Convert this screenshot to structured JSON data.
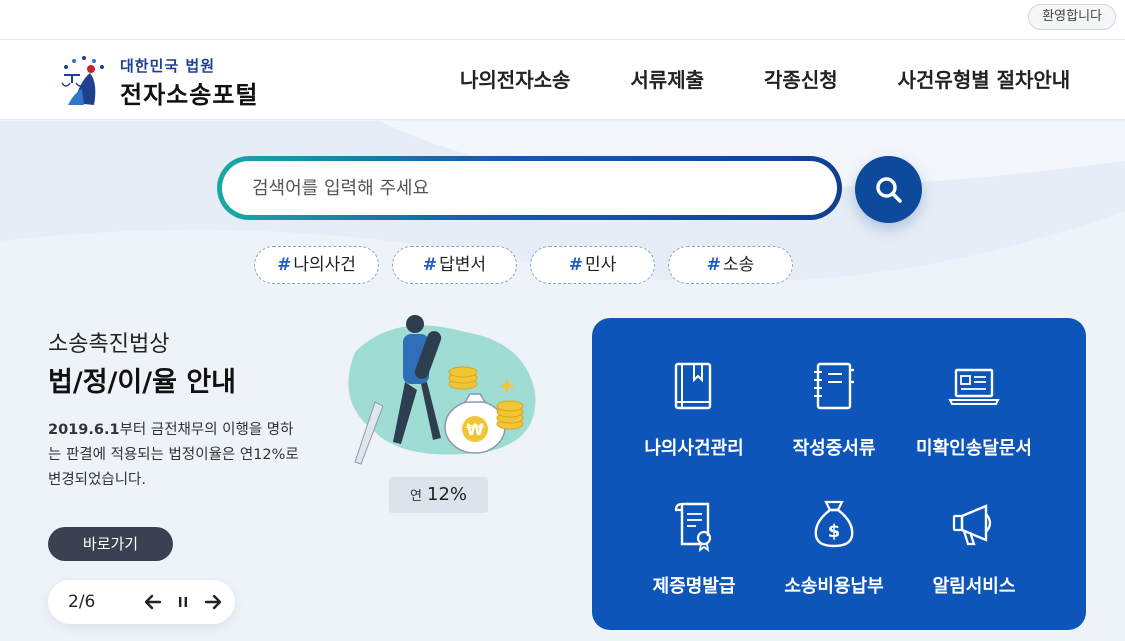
{
  "topbar": {
    "welcome": "환영합니다"
  },
  "header": {
    "logo_sub": "대한민국 법원",
    "logo_main": "전자소송포털",
    "nav": [
      "나의전자소송",
      "서류제출",
      "각종신청",
      "사건유형별 절차안내"
    ]
  },
  "search": {
    "placeholder": "검색어를 입력해 주세요",
    "button_icon": "search-icon"
  },
  "hashtags": [
    {
      "hash": "#",
      "label": "나의사건"
    },
    {
      "hash": "#",
      "label": "답변서"
    },
    {
      "hash": "#",
      "label": "민사"
    },
    {
      "hash": "#",
      "label": "소송"
    }
  ],
  "banner": {
    "subtitle": "소송촉진법상",
    "title": "법/정/이/율 안내",
    "desc_bold": "2019.6.1",
    "desc_rest": "부터 금전채무의 이행을 명하는 판결에 적용되는 법정이율은 연12%로 변경되었습니다.",
    "rate_prefix": "연",
    "rate_value": "12%",
    "button": "바로가기",
    "pager": "2/6"
  },
  "quick_menu": [
    {
      "label": "나의사건관리",
      "icon": "book-icon"
    },
    {
      "label": "작성중서류",
      "icon": "notebook-icon"
    },
    {
      "label": "미확인송달문서",
      "icon": "laptop-icon"
    },
    {
      "label": "제증명발급",
      "icon": "certificate-icon"
    },
    {
      "label": "소송비용납부",
      "icon": "money-bag-icon"
    },
    {
      "label": "알림서비스",
      "icon": "megaphone-icon"
    }
  ],
  "colors": {
    "primary": "#0d55b8",
    "search_button": "#0d4a9b",
    "search_gradient_start": "#1aa9a5",
    "hashtag": "#1f5fbf",
    "dark_button": "#3b4150"
  }
}
